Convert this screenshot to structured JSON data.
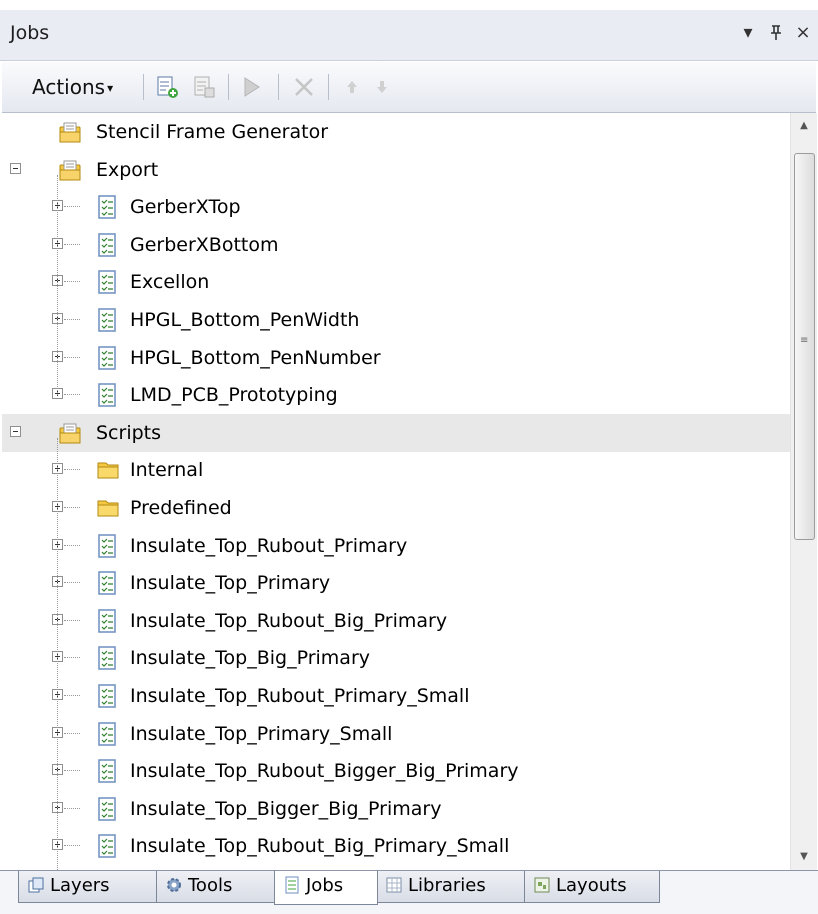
{
  "panel": {
    "title": "Jobs",
    "dropdown_glyph": "▾",
    "pin_glyph": "ᵖ",
    "close_glyph": "×"
  },
  "toolbar": {
    "actions_label": "Actions",
    "actions_caret": "▾",
    "icons": [
      "new-job-icon",
      "copy-job-icon",
      "run-icon",
      "delete-icon",
      "move-up-icon",
      "move-down-icon"
    ]
  },
  "tree": {
    "items": [
      {
        "label": "Stencil Frame Generator",
        "type": "job-folder",
        "level": 0,
        "expander": "none"
      },
      {
        "label": "Export",
        "type": "job-folder",
        "level": 0,
        "expander": "minus"
      },
      {
        "label": "GerberXTop",
        "type": "job",
        "level": 1,
        "expander": "plus"
      },
      {
        "label": "GerberXBottom",
        "type": "job",
        "level": 1,
        "expander": "plus"
      },
      {
        "label": "Excellon",
        "type": "job",
        "level": 1,
        "expander": "plus"
      },
      {
        "label": "HPGL_Bottom_PenWidth",
        "type": "job",
        "level": 1,
        "expander": "plus"
      },
      {
        "label": "HPGL_Bottom_PenNumber",
        "type": "job",
        "level": 1,
        "expander": "plus"
      },
      {
        "label": "LMD_PCB_Prototyping",
        "type": "job",
        "level": 1,
        "expander": "plus"
      },
      {
        "label": "Scripts",
        "type": "job-folder",
        "level": 0,
        "expander": "minus",
        "selected": true
      },
      {
        "label": "Internal",
        "type": "folder",
        "level": 1,
        "expander": "plus"
      },
      {
        "label": "Predefined",
        "type": "folder",
        "level": 1,
        "expander": "plus"
      },
      {
        "label": "Insulate_Top_Rubout_Primary",
        "type": "job",
        "level": 1,
        "expander": "plus"
      },
      {
        "label": "Insulate_Top_Primary",
        "type": "job",
        "level": 1,
        "expander": "plus"
      },
      {
        "label": "Insulate_Top_Rubout_Big_Primary",
        "type": "job",
        "level": 1,
        "expander": "plus"
      },
      {
        "label": "Insulate_Top_Big_Primary",
        "type": "job",
        "level": 1,
        "expander": "plus"
      },
      {
        "label": "Insulate_Top_Rubout_Primary_Small",
        "type": "job",
        "level": 1,
        "expander": "plus"
      },
      {
        "label": "Insulate_Top_Primary_Small",
        "type": "job",
        "level": 1,
        "expander": "plus"
      },
      {
        "label": "Insulate_Top_Rubout_Bigger_Big_Primary",
        "type": "job",
        "level": 1,
        "expander": "plus"
      },
      {
        "label": "Insulate_Top_Bigger_Big_Primary",
        "type": "job",
        "level": 1,
        "expander": "plus"
      },
      {
        "label": "Insulate_Top_Rubout_Big_Primary_Small",
        "type": "job",
        "level": 1,
        "expander": "plus"
      }
    ]
  },
  "scrollbar": {
    "up_glyph": "▲",
    "down_glyph": "▼",
    "grip_glyph": "≡"
  },
  "tabs": [
    {
      "label": "Layers",
      "icon": "layers-icon",
      "active": false
    },
    {
      "label": "Tools",
      "icon": "tools-gear-icon",
      "active": false
    },
    {
      "label": "Jobs",
      "icon": "jobs-icon",
      "active": true
    },
    {
      "label": "Libraries",
      "icon": "libraries-icon",
      "active": false
    },
    {
      "label": "Layouts",
      "icon": "layouts-icon",
      "active": false
    }
  ],
  "colors": {
    "folder": "#f5c842",
    "job_icon": "#6c8fbf",
    "selection": "#e8e8e8",
    "titlebar": "#e9ecf3"
  }
}
